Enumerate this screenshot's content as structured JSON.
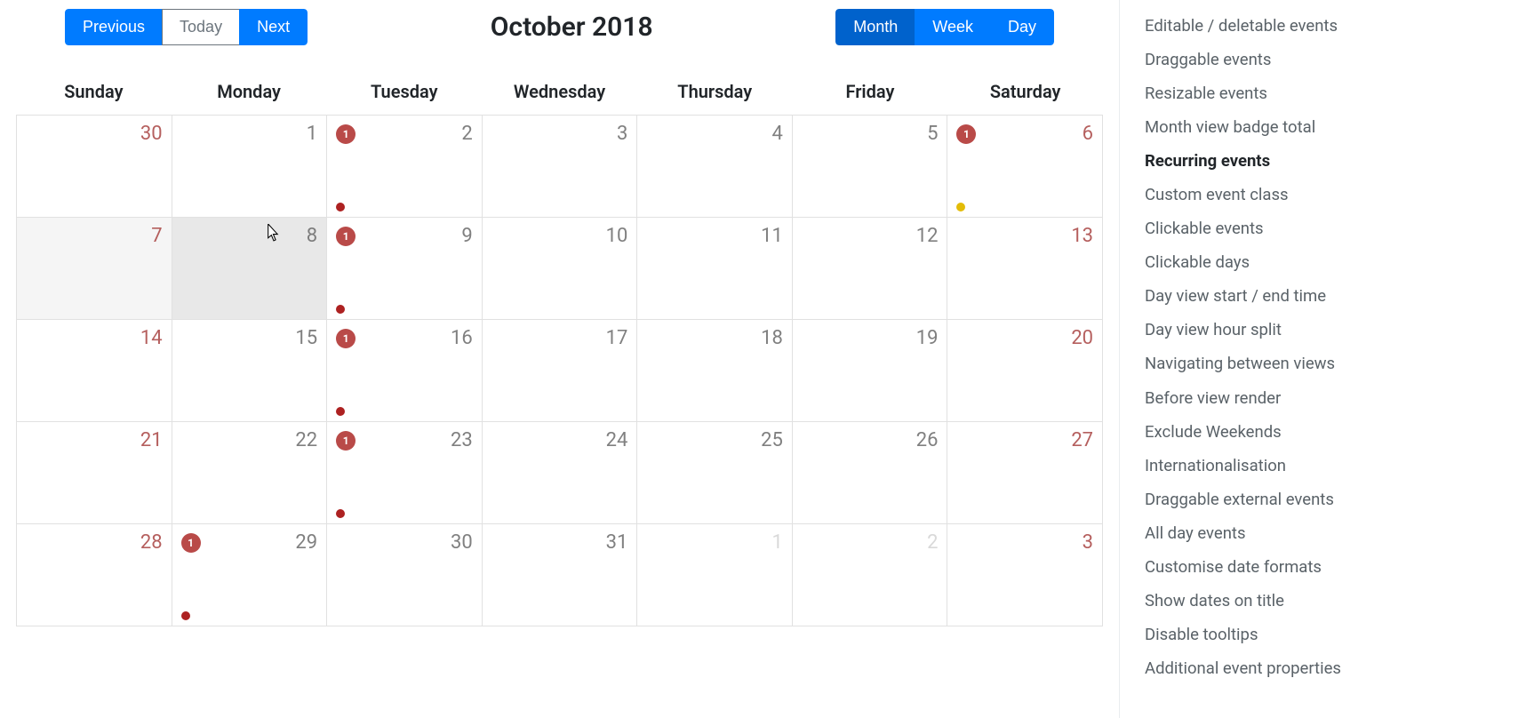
{
  "title": "October 2018",
  "nav": {
    "previous": "Previous",
    "today": "Today",
    "next": "Next"
  },
  "views": {
    "month": "Month",
    "week": "Week",
    "day": "Day",
    "active": "Month"
  },
  "day_headers": [
    "Sunday",
    "Monday",
    "Tuesday",
    "Wednesday",
    "Thursday",
    "Friday",
    "Saturday"
  ],
  "weeks": [
    [
      {
        "day": 30,
        "out": true,
        "weekend": true,
        "past": false,
        "badge": null,
        "dots": []
      },
      {
        "day": 1,
        "out": false,
        "weekend": false,
        "past": false,
        "badge": null,
        "dots": []
      },
      {
        "day": 2,
        "out": false,
        "weekend": false,
        "past": false,
        "badge": 1,
        "dots": [
          "#ad2121"
        ]
      },
      {
        "day": 3,
        "out": false,
        "weekend": false,
        "past": false,
        "badge": null,
        "dots": []
      },
      {
        "day": 4,
        "out": false,
        "weekend": false,
        "past": false,
        "badge": null,
        "dots": []
      },
      {
        "day": 5,
        "out": false,
        "weekend": false,
        "past": false,
        "badge": null,
        "dots": []
      },
      {
        "day": 6,
        "out": false,
        "weekend": true,
        "past": false,
        "badge": 1,
        "dots": [
          "#e3bc08"
        ]
      }
    ],
    [
      {
        "day": 7,
        "out": false,
        "weekend": true,
        "past": true,
        "badge": null,
        "dots": []
      },
      {
        "day": 8,
        "out": false,
        "weekend": false,
        "past": false,
        "today": true,
        "badge": null,
        "dots": []
      },
      {
        "day": 9,
        "out": false,
        "weekend": false,
        "past": false,
        "badge": 1,
        "dots": [
          "#ad2121"
        ]
      },
      {
        "day": 10,
        "out": false,
        "weekend": false,
        "past": false,
        "badge": null,
        "dots": []
      },
      {
        "day": 11,
        "out": false,
        "weekend": false,
        "past": false,
        "badge": null,
        "dots": []
      },
      {
        "day": 12,
        "out": false,
        "weekend": false,
        "past": false,
        "badge": null,
        "dots": []
      },
      {
        "day": 13,
        "out": false,
        "weekend": true,
        "past": false,
        "badge": null,
        "dots": []
      }
    ],
    [
      {
        "day": 14,
        "out": false,
        "weekend": true,
        "past": false,
        "badge": null,
        "dots": []
      },
      {
        "day": 15,
        "out": false,
        "weekend": false,
        "past": false,
        "badge": null,
        "dots": []
      },
      {
        "day": 16,
        "out": false,
        "weekend": false,
        "past": false,
        "badge": 1,
        "dots": [
          "#ad2121"
        ]
      },
      {
        "day": 17,
        "out": false,
        "weekend": false,
        "past": false,
        "badge": null,
        "dots": []
      },
      {
        "day": 18,
        "out": false,
        "weekend": false,
        "past": false,
        "badge": null,
        "dots": []
      },
      {
        "day": 19,
        "out": false,
        "weekend": false,
        "past": false,
        "badge": null,
        "dots": []
      },
      {
        "day": 20,
        "out": false,
        "weekend": true,
        "past": false,
        "badge": null,
        "dots": []
      }
    ],
    [
      {
        "day": 21,
        "out": false,
        "weekend": true,
        "past": false,
        "badge": null,
        "dots": []
      },
      {
        "day": 22,
        "out": false,
        "weekend": false,
        "past": false,
        "badge": null,
        "dots": []
      },
      {
        "day": 23,
        "out": false,
        "weekend": false,
        "past": false,
        "badge": 1,
        "dots": [
          "#ad2121"
        ]
      },
      {
        "day": 24,
        "out": false,
        "weekend": false,
        "past": false,
        "badge": null,
        "dots": []
      },
      {
        "day": 25,
        "out": false,
        "weekend": false,
        "past": false,
        "badge": null,
        "dots": []
      },
      {
        "day": 26,
        "out": false,
        "weekend": false,
        "past": false,
        "badge": null,
        "dots": []
      },
      {
        "day": 27,
        "out": false,
        "weekend": true,
        "past": false,
        "badge": null,
        "dots": []
      }
    ],
    [
      {
        "day": 28,
        "out": false,
        "weekend": true,
        "past": false,
        "badge": null,
        "dots": []
      },
      {
        "day": 29,
        "out": false,
        "weekend": false,
        "past": false,
        "badge": 1,
        "dots": [
          "#ad2121"
        ]
      },
      {
        "day": 30,
        "out": false,
        "weekend": false,
        "past": false,
        "badge": null,
        "dots": []
      },
      {
        "day": 31,
        "out": false,
        "weekend": false,
        "past": false,
        "badge": null,
        "dots": []
      },
      {
        "day": 1,
        "out": true,
        "weekend": false,
        "past": false,
        "badge": null,
        "dots": []
      },
      {
        "day": 2,
        "out": true,
        "weekend": false,
        "past": false,
        "badge": null,
        "dots": []
      },
      {
        "day": 3,
        "out": true,
        "weekend": true,
        "past": false,
        "badge": null,
        "dots": []
      }
    ]
  ],
  "sidebar": {
    "active_index": 4,
    "items": [
      "Editable / deletable events",
      "Draggable events",
      "Resizable events",
      "Month view badge total",
      "Recurring events",
      "Custom event class",
      "Clickable events",
      "Clickable days",
      "Day view start / end time",
      "Day view hour split",
      "Navigating between views",
      "Before view render",
      "Exclude Weekends",
      "Internationalisation",
      "Draggable external events",
      "All day events",
      "Customise date formats",
      "Show dates on title",
      "Disable tooltips",
      "Additional event properties"
    ]
  },
  "colors": {
    "primary": "#007bff",
    "primary_active": "#0062cc",
    "badge_bg": "#b94a48"
  }
}
